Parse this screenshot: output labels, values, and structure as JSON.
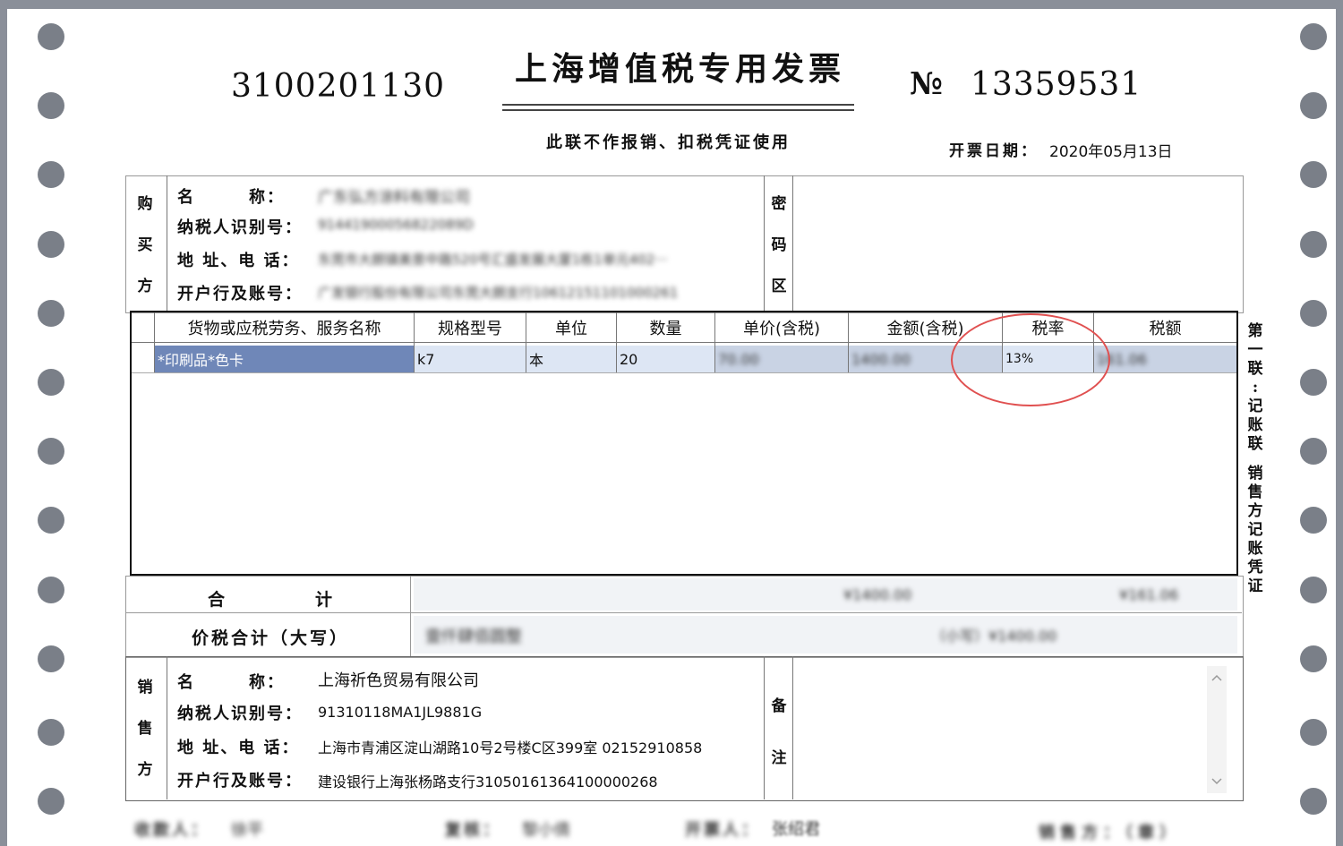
{
  "invoice": {
    "code": "3100201130",
    "title": "上海增值税专用发票",
    "no_label": "№",
    "number": "13359531",
    "subtitle": "此联不作报销、扣税凭证使用",
    "date_label": "开票日期：",
    "date_value": "2020年05月13日"
  },
  "buyer": {
    "side_label": [
      "购",
      "买",
      "方"
    ],
    "name_label": "名　　　称：",
    "name_value": "广东弘方涂料有限公司",
    "taxid_label": "纳税人识别号：",
    "taxid_value": "91441900056822089D",
    "addr_label": "地 址、电 话：",
    "addr_value": "东莞市大朗镇美景中路520号汇盛发展大厦1栋1单元402···",
    "bank_label": "开户行及账号：",
    "bank_value": "广发银行股份有限公司东莞大朗支行10612151101000261"
  },
  "cipher": {
    "side_label": [
      "密",
      "码",
      "区"
    ]
  },
  "items": {
    "headers": [
      "货物或应税劳务、服务名称",
      "规格型号",
      "单位",
      "数量",
      "单价(含税)",
      "金额(含税)",
      "税率",
      "税额"
    ],
    "rows": [
      {
        "name": "*印刷品*色卡",
        "spec": "k7",
        "unit": "本",
        "qty": "20",
        "price": "70.00",
        "amount": "1400.00",
        "rate": "13%",
        "tax": "161.06"
      }
    ]
  },
  "totals": {
    "sum_label": [
      "合",
      "计"
    ],
    "sum_amount": "¥1400.00",
    "sum_tax": "¥161.06",
    "grand_label": "价税合计（大写）",
    "grand_words": "壹仟肆佰圆整",
    "grand_small": "（小写）¥1400.00"
  },
  "seller": {
    "side_label": [
      "销",
      "售",
      "方"
    ],
    "name_label": "名　　　称：",
    "name_value": "上海祈色贸易有限公司",
    "taxid_label": "纳税人识别号：",
    "taxid_value": "91310118MA1JL9881G",
    "addr_label": "地 址、电 话：",
    "addr_value": "上海市青浦区淀山湖路10号2号楼C区399室 02152910858",
    "bank_label": "开户行及账号：",
    "bank_value": "建设银行上海张杨路支行31050161364100000268"
  },
  "remark": {
    "side_label": [
      "备",
      "注"
    ]
  },
  "copy_label": [
    "第",
    "一",
    "联",
    ":",
    "记",
    "账",
    "联",
    "",
    "销",
    "售",
    "方",
    "记",
    "账",
    "凭",
    "证"
  ],
  "footer": {
    "payee_label": "收款人：",
    "payee_value": "徐平",
    "review_label": "复核：",
    "review_value": "黎小倩",
    "drawer_label": "开票人：",
    "drawer_value": "张绍君",
    "seller_label": "销售方：（章）"
  },
  "colors": {
    "selection": "#6f87b8",
    "row_bg": "#dde6f4",
    "annotation": "#e05050"
  },
  "icons": {
    "scroll_up": "chevron-up-icon",
    "scroll_down": "chevron-down-icon"
  }
}
